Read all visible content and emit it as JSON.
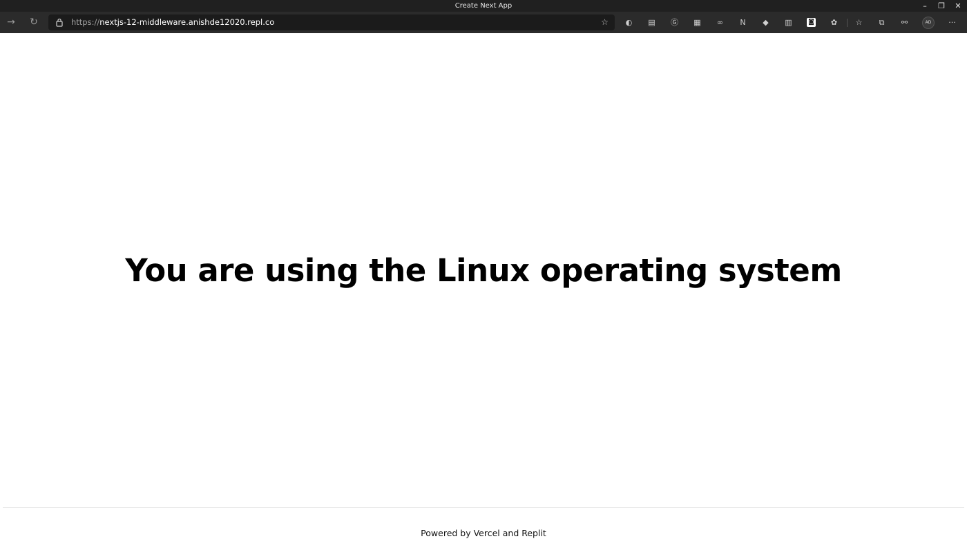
{
  "window": {
    "title": "Create Next App",
    "controls": {
      "minimize": "–",
      "restore": "❐",
      "close": "✕"
    }
  },
  "toolbar": {
    "back_icon": "→",
    "reload_icon": "↻",
    "url_scheme": "https://",
    "url_host": "nextjs-12-middleware.anishde12020.repl.co",
    "favorite_add_icon": "☆",
    "extension_icons": [
      "◐",
      "▤",
      "Ⓖ",
      "▦",
      "∞",
      "N",
      "◆",
      "▥",
      "◙",
      "✿"
    ],
    "favorites_icon": "☆",
    "collections_icon": "⧉",
    "share_icon": "⚯",
    "profile_initials": "AD",
    "more_icon": "···"
  },
  "main": {
    "heading": "You are using the Linux operating system"
  },
  "footer": {
    "text": "Powered by Vercel and Replit"
  }
}
